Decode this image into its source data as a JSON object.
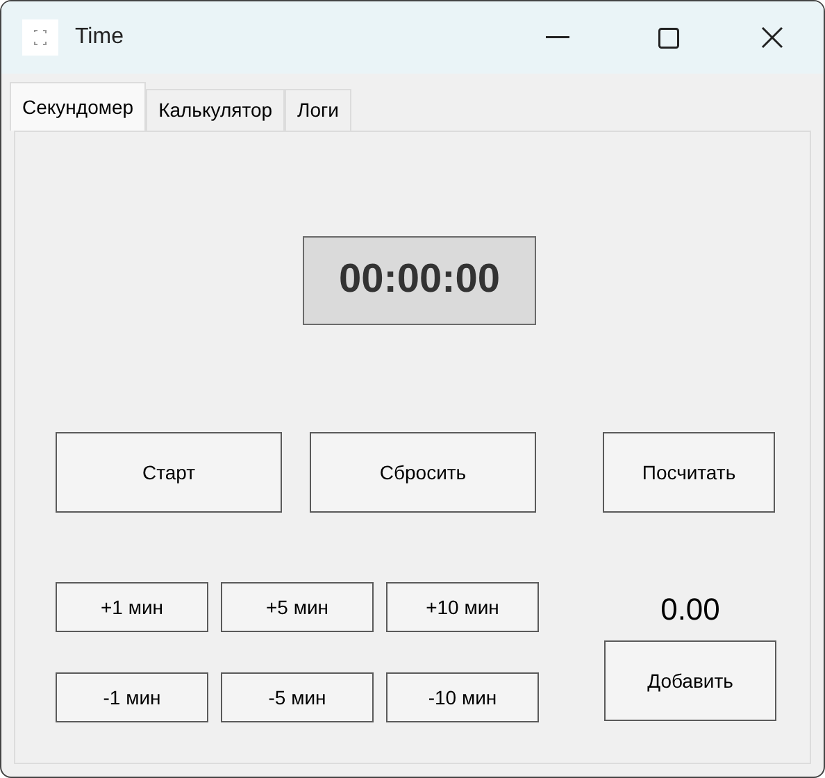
{
  "window": {
    "title": "Time"
  },
  "tabs": [
    {
      "label": "Секундомер",
      "selected": true
    },
    {
      "label": "Калькулятор",
      "selected": false
    },
    {
      "label": "Логи",
      "selected": false
    }
  ],
  "timer": {
    "display": "00:00:00"
  },
  "main_buttons": [
    "Старт",
    "Сбросить"
  ],
  "count_button": "Посчитать",
  "adjust_buttons": [
    [
      "+1 мин",
      "+5 мин",
      "+10 мин"
    ],
    [
      "-1 мин",
      "-5 мин",
      "-10 мин"
    ]
  ],
  "result": "0.00",
  "add_button": "Добавить"
}
